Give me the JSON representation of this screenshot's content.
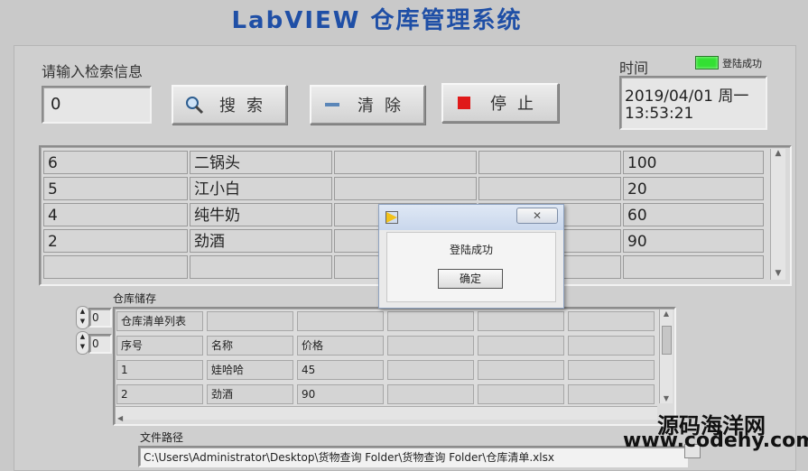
{
  "app": {
    "title": "LabVIEW 仓库管理系统"
  },
  "search": {
    "label": "请输入检索信息",
    "value": "0",
    "search_button": "搜索",
    "clear_button": "清除",
    "stop_button": "停止"
  },
  "time": {
    "label": "时间",
    "line1": "2019/04/01 周一",
    "line2": "13:53:21"
  },
  "status": {
    "led_label": "登陆成功",
    "led_color": "#33e033"
  },
  "results_table": {
    "rows": [
      [
        "6",
        "二锅头",
        "",
        "",
        "100"
      ],
      [
        "5",
        "江小白",
        "",
        "",
        "20"
      ],
      [
        "4",
        "纯牛奶",
        "",
        "",
        "60"
      ],
      [
        "2",
        "劲酒",
        "",
        "",
        "90"
      ],
      [
        "",
        "",
        "",
        "",
        ""
      ]
    ]
  },
  "storage": {
    "label": "仓库储存",
    "index_row": "0",
    "index_col": "0",
    "grid": [
      [
        "仓库清单列表",
        "",
        "",
        "",
        "",
        ""
      ],
      [
        "序号",
        "名称",
        "价格",
        "",
        "",
        ""
      ],
      [
        "1",
        "娃哈哈",
        "45",
        "",
        "",
        ""
      ],
      [
        "2",
        "劲酒",
        "90",
        "",
        "",
        ""
      ]
    ]
  },
  "file": {
    "label": "文件路径",
    "path": "C:\\Users\\Administrator\\Desktop\\货物查询 Folder\\货物查询 Folder\\仓库清单.xlsx"
  },
  "dialog": {
    "message": "登陆成功",
    "ok_button": "确定"
  },
  "watermark": {
    "line1": "源码海洋网",
    "line2": "www.codehy.com"
  }
}
